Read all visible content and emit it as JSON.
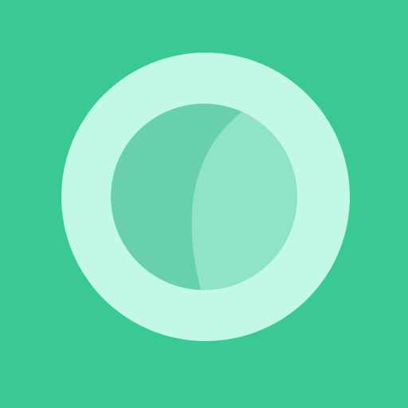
{
  "icon": {
    "name": "lens-icon",
    "colors": {
      "background": "#3AC893",
      "outer_ring": "#C1F8E6",
      "inner_disc_left": "#68D1AB",
      "inner_disc_right": "#8FE3C7"
    }
  }
}
